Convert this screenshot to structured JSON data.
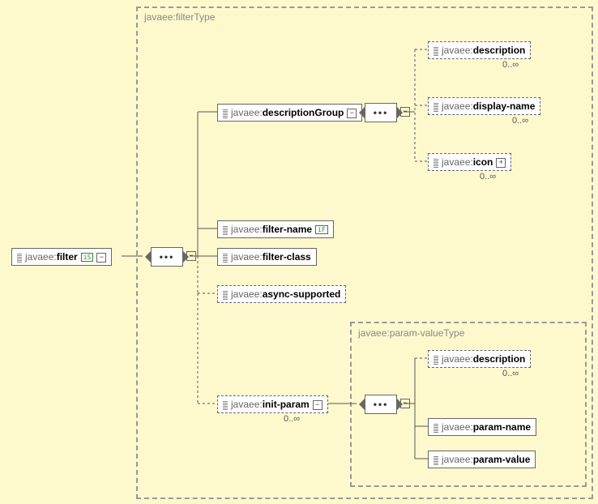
{
  "chart_data": {
    "type": "tree",
    "title": "javaee:filterType",
    "root": {
      "name": "javaee:filter",
      "children": [
        {
          "name": "sequence",
          "group": "javaee:filterType",
          "children": [
            {
              "name": "javaee:descriptionGroup",
              "children": [
                {
                  "name": "sequence",
                  "children": [
                    {
                      "name": "javaee:description",
                      "cardinality": "0..∞",
                      "optional": true
                    },
                    {
                      "name": "javaee:display-name",
                      "cardinality": "0..∞",
                      "optional": true
                    },
                    {
                      "name": "javaee:icon",
                      "cardinality": "0..∞",
                      "optional": true,
                      "expandable": true
                    }
                  ]
                }
              ]
            },
            {
              "name": "javaee:filter-name"
            },
            {
              "name": "javaee:filter-class"
            },
            {
              "name": "javaee:async-supported",
              "optional": true
            },
            {
              "name": "javaee:init-param",
              "cardinality": "0..∞",
              "optional": true,
              "group": "javaee:param-valueType",
              "children": [
                {
                  "name": "sequence",
                  "children": [
                    {
                      "name": "javaee:description",
                      "cardinality": "0..∞",
                      "optional": true
                    },
                    {
                      "name": "javaee:param-name"
                    },
                    {
                      "name": "javaee:param-value"
                    }
                  ]
                }
              ]
            }
          ]
        }
      ]
    }
  },
  "groupMain": "javaee:filterType",
  "groupParam": "javaee:param-valueType",
  "root": {
    "pre": "javaee:",
    "name": "filter"
  },
  "descGroup": {
    "pre": "javaee:",
    "name": "descriptionGroup"
  },
  "description": {
    "pre": "javaee:",
    "name": "description"
  },
  "displayName": {
    "pre": "javaee:",
    "name": "display-name"
  },
  "icon": {
    "pre": "javaee:",
    "name": "icon"
  },
  "filterName": {
    "pre": "javaee:",
    "name": "filter-name"
  },
  "filterClass": {
    "pre": "javaee:",
    "name": "filter-class"
  },
  "asyncSup": {
    "pre": "javaee:",
    "name": "async-supported"
  },
  "initParam": {
    "pre": "javaee:",
    "name": "init-param"
  },
  "paramName": {
    "pre": "javaee:",
    "name": "param-name"
  },
  "paramValue": {
    "pre": "javaee:",
    "name": "param-value"
  },
  "card": "0..∞",
  "dots": "•••"
}
